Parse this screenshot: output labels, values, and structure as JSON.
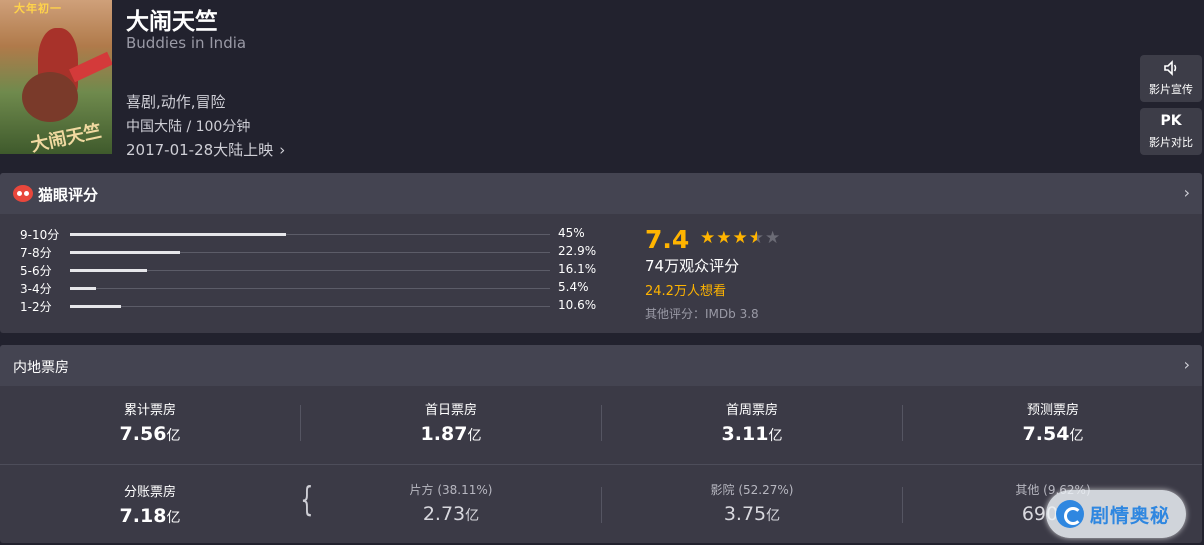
{
  "movie": {
    "title_cn": "大闹天竺",
    "title_en": "Buddies in India",
    "genres": "喜剧,动作,冒险",
    "region_duration": "中国大陆 / 100分钟",
    "release": "2017-01-28大陆上映",
    "poster_caption": "大年初一",
    "poster_logo": "大闹天竺"
  },
  "actions": {
    "trailer_label": "影片宣传",
    "compare_icon": "PK",
    "compare_label": "影片对比"
  },
  "rating": {
    "title": "猫眼评分",
    "score": "7.4",
    "stars": {
      "full": 3,
      "half": 1,
      "empty": 1
    },
    "raters": "74万观众评分",
    "wish": "24.2万人想看",
    "other": "其他评分：IMDb 3.8",
    "distribution": [
      {
        "label": "9-10分",
        "pct": "45%",
        "value": 45
      },
      {
        "label": "7-8分",
        "pct": "22.9%",
        "value": 22.9
      },
      {
        "label": "5-6分",
        "pct": "16.1%",
        "value": 16.1
      },
      {
        "label": "3-4分",
        "pct": "5.4%",
        "value": 5.4
      },
      {
        "label": "1-2分",
        "pct": "10.6%",
        "value": 10.6
      }
    ]
  },
  "box_office": {
    "title": "内地票房",
    "row1": [
      {
        "label": "累计票房",
        "value": "7.56",
        "unit": "亿"
      },
      {
        "label": "首日票房",
        "value": "1.87",
        "unit": "亿"
      },
      {
        "label": "首周票房",
        "value": "3.11",
        "unit": "亿"
      },
      {
        "label": "预测票房",
        "value": "7.54",
        "unit": "亿"
      }
    ],
    "row2": [
      {
        "label": "分账票房",
        "value": "7.18",
        "unit": "亿"
      },
      {
        "label": "片方 (38.11%)",
        "value": "2.73",
        "unit": "亿"
      },
      {
        "label": "影院 (52.27%)",
        "value": "3.75",
        "unit": "亿"
      },
      {
        "label": "其他 (9.62%)",
        "value": "6906",
        "unit": "万"
      }
    ]
  },
  "watermark": "剧情奥秘",
  "colors": {
    "accent": "#ffb400",
    "bg": "#22222e",
    "panel": "#3b3a46",
    "logo_red": "#e8473c"
  },
  "icons": [
    "speaker-icon",
    "chevron-right-icon",
    "maoyan-cat-icon",
    "star-icon"
  ]
}
